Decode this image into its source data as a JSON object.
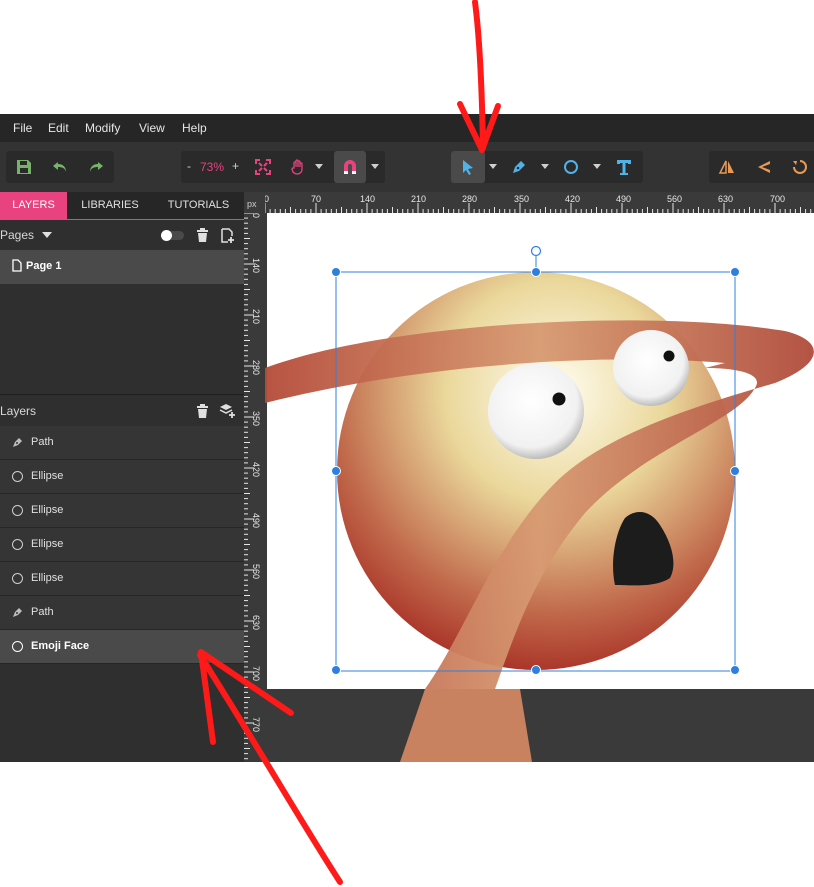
{
  "menu": [
    "File",
    "Edit",
    "Modify",
    "View",
    "Help"
  ],
  "toolbar": {
    "zoom_minus": "-",
    "zoom_value": "73%",
    "zoom_plus": "+"
  },
  "panel": {
    "tabs": [
      "LAYERS",
      "LIBRARIES",
      "TUTORIALS"
    ],
    "pages_title": "Pages",
    "page_name": "Page 1",
    "layers_title": "Layers",
    "layers": [
      "Path",
      "Ellipse",
      "Ellipse",
      "Ellipse",
      "Ellipse",
      "Path",
      "Emoji Face"
    ]
  },
  "ruler": {
    "unit": "px",
    "top_ticks": [
      "0",
      "70",
      "140",
      "210",
      "280",
      "350",
      "420",
      "490",
      "560",
      "630",
      "700"
    ],
    "left_ticks": [
      "0",
      "140",
      "210",
      "280",
      "350",
      "420",
      "490",
      "560",
      "630",
      "700",
      "770"
    ]
  },
  "colors": {
    "accent": "#e8437f",
    "selection": "#2f7fe0",
    "annotation": "#ff1a1a"
  }
}
